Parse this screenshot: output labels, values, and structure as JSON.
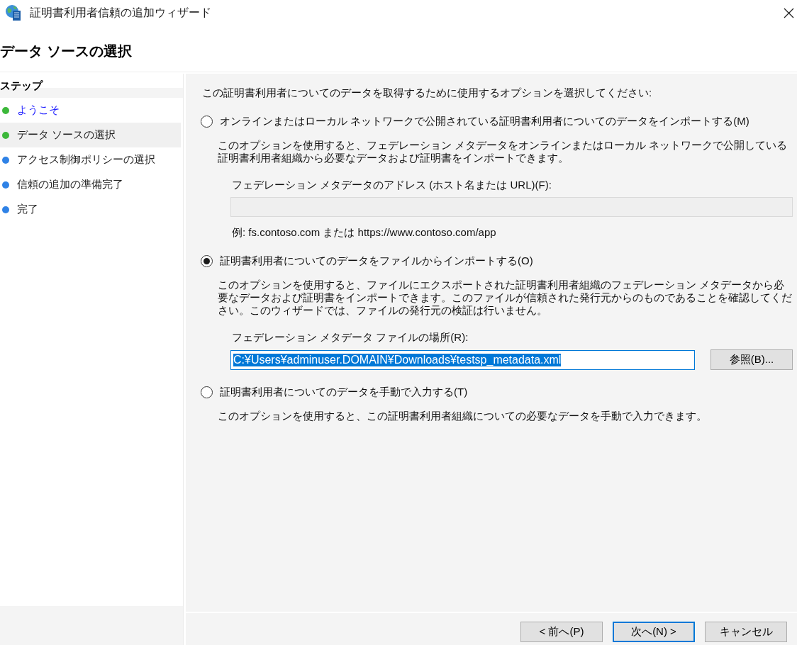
{
  "window": {
    "title": "証明書利用者信頼の追加ウィザード"
  },
  "page_title": "データ ソースの選択",
  "steps": {
    "heading": "ステップ",
    "items": [
      {
        "label": "ようこそ",
        "link": true,
        "selected": false,
        "color": "#3cb83a"
      },
      {
        "label": "データ ソースの選択",
        "link": false,
        "selected": true,
        "color": "#3cb83a"
      },
      {
        "label": "アクセス制御ポリシーの選択",
        "link": false,
        "selected": false,
        "color": "#2f82e6"
      },
      {
        "label": "信頼の追加の準備完了",
        "link": false,
        "selected": false,
        "color": "#2f82e6"
      },
      {
        "label": "完了",
        "link": false,
        "selected": false,
        "color": "#2f82e6"
      }
    ]
  },
  "content": {
    "prompt": "この証明書利用者についてのデータを取得するために使用するオプションを選択してください:",
    "options": [
      {
        "label": "オンラインまたはローカル ネットワークで公開されている証明書利用者についてのデータをインポートする(M)",
        "selected": false,
        "description": "このオプションを使用すると、フェデレーション メタデータをオンラインまたはローカル ネットワークで公開している証明書利用者組織から必要なデータおよび証明書をインポートできます。",
        "field": {
          "label": "フェデレーション メタデータのアドレス (ホスト名または URL)(F):",
          "disabled": true,
          "focused": false,
          "example": "例: fs.contoso.com または https://www.contoso.com/app"
        }
      },
      {
        "label": "証明書利用者についてのデータをファイルからインポートする(O)",
        "selected": true,
        "description": "このオプションを使用すると、ファイルにエクスポートされた証明書利用者組織のフェデレーション メタデータから必要なデータおよび証明書をインポートできます。このファイルが信頼された発行元からのものであることを確認してください。このウィザードでは、ファイルの発行元の検証は行いません。",
        "field": {
          "label": "フェデレーション メタデータ ファイルの場所(R):",
          "disabled": false,
          "focused": true,
          "value": "C:¥Users¥adminuser.DOMAIN¥Downloads¥testsp_metadata.xml",
          "browse_button": "参照(B)..."
        }
      },
      {
        "label": "証明書利用者についてのデータを手動で入力する(T)",
        "selected": false,
        "description": "このオプションを使用すると、この証明書利用者組織についての必要なデータを手動で入力できます。"
      }
    ]
  },
  "buttons": [
    {
      "label": "< 前へ(P)",
      "default": false
    },
    {
      "label": "次へ(N) >",
      "default": true
    },
    {
      "label": "キャンセル",
      "default": false
    }
  ]
}
